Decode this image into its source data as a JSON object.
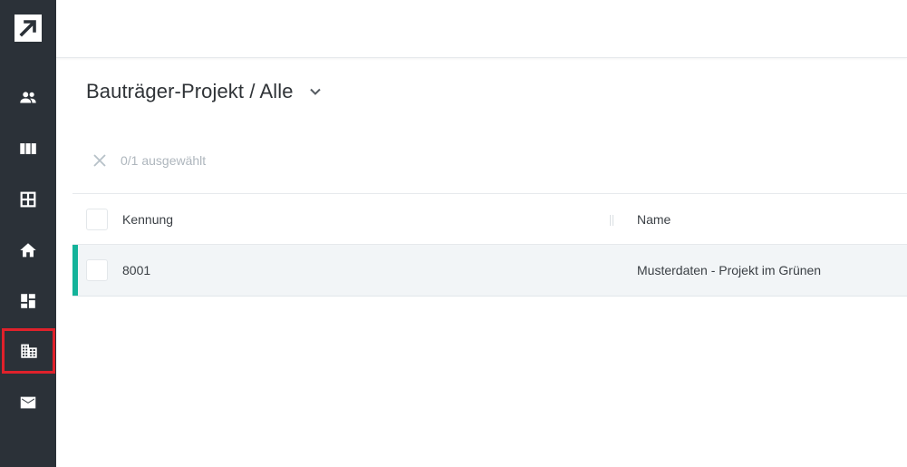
{
  "sidebar": {
    "items": [
      {
        "icon": "people-icon"
      },
      {
        "icon": "columns-icon"
      },
      {
        "icon": "grid-icon"
      },
      {
        "icon": "home-icon"
      },
      {
        "icon": "dashboard-icon"
      },
      {
        "icon": "building-icon"
      },
      {
        "icon": "mail-icon"
      }
    ]
  },
  "header": {
    "title": "Bauträger-Projekt / Alle"
  },
  "selection": {
    "text": "0/1 ausgewählt"
  },
  "table": {
    "columns": [
      "Kennung",
      "Name"
    ],
    "rows": [
      {
        "id": "8001",
        "name": "Musterdaten - Projekt im Grünen"
      }
    ]
  },
  "colors": {
    "sidebar_bg": "#2b3138",
    "accent": "#14b39a",
    "highlight_border": "#e0212b"
  }
}
